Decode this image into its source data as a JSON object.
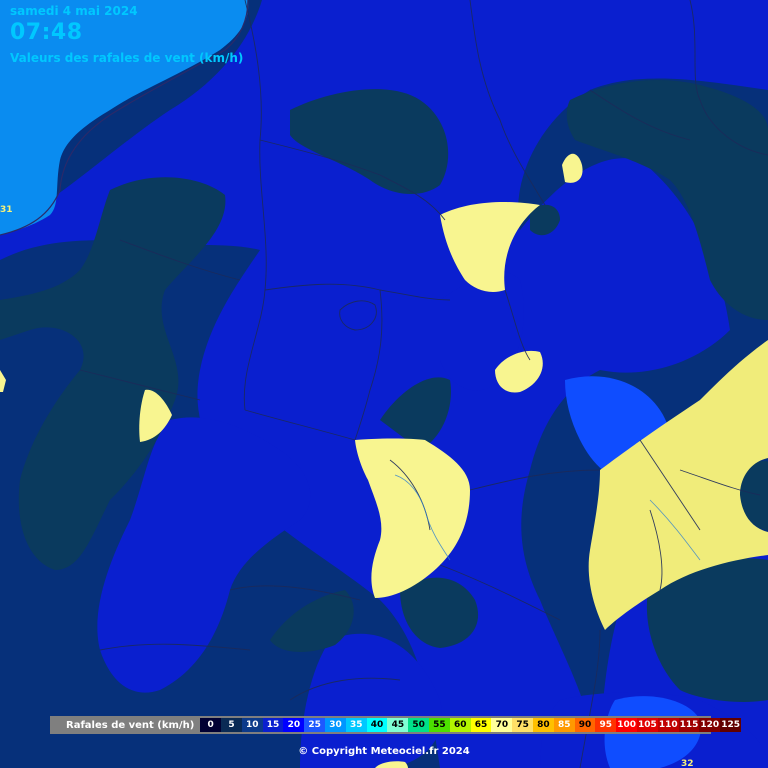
{
  "header": {
    "date": "samedi 4 mai 2024",
    "time": "07:48",
    "description": "Valeurs des rafales de vent (km/h)"
  },
  "edge_values": {
    "left": "31",
    "bottom_right": "32"
  },
  "legend": {
    "title": "Rafales de vent (km/h)",
    "steps": [
      {
        "label": "0",
        "color": "#000033",
        "text": "#ffffff"
      },
      {
        "label": "5",
        "color": "#0a2a55",
        "text": "#ffffff"
      },
      {
        "label": "10",
        "color": "#0c3a8a",
        "text": "#ffffff"
      },
      {
        "label": "15",
        "color": "#0a1fcf",
        "text": "#ffffff"
      },
      {
        "label": "20",
        "color": "#0000ff",
        "text": "#ffffff"
      },
      {
        "label": "25",
        "color": "#1e58ff",
        "text": "#ffffff"
      },
      {
        "label": "30",
        "color": "#0096ff",
        "text": "#ffffff"
      },
      {
        "label": "35",
        "color": "#00c8ff",
        "text": "#ffffff"
      },
      {
        "label": "40",
        "color": "#00ffff",
        "text": "#000000"
      },
      {
        "label": "45",
        "color": "#7fffd4",
        "text": "#000000"
      },
      {
        "label": "50",
        "color": "#00e08a",
        "text": "#000000"
      },
      {
        "label": "55",
        "color": "#4ce000",
        "text": "#000000"
      },
      {
        "label": "60",
        "color": "#b4f500",
        "text": "#000000"
      },
      {
        "label": "65",
        "color": "#ffff00",
        "text": "#000000"
      },
      {
        "label": "70",
        "color": "#ffff99",
        "text": "#000000"
      },
      {
        "label": "75",
        "color": "#ffe066",
        "text": "#000000"
      },
      {
        "label": "80",
        "color": "#ffc000",
        "text": "#000000"
      },
      {
        "label": "85",
        "color": "#ff9900",
        "text": "#ffffff"
      },
      {
        "label": "90",
        "color": "#ff6600",
        "text": "#000000"
      },
      {
        "label": "95",
        "color": "#ff3300",
        "text": "#ffffff"
      },
      {
        "label": "100",
        "color": "#ff0000",
        "text": "#ffffff"
      },
      {
        "label": "105",
        "color": "#e00000",
        "text": "#ffffff"
      },
      {
        "label": "110",
        "color": "#c00000",
        "text": "#ffffff"
      },
      {
        "label": "115",
        "color": "#a00000",
        "text": "#ffffff"
      },
      {
        "label": "120",
        "color": "#800000",
        "text": "#ffffff"
      },
      {
        "label": "125",
        "color": "#600000",
        "text": "#ffffff"
      }
    ]
  },
  "copyright": "© Copyright Meteociel.fr 2024"
}
